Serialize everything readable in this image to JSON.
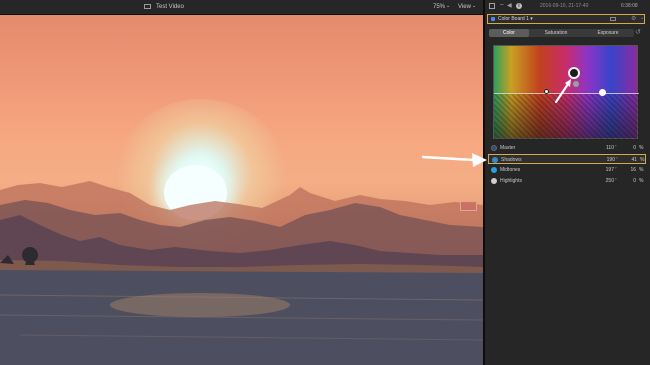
{
  "viewer": {
    "title": "Test Video",
    "zoom": "75%",
    "zoom_chevron": "⌄",
    "view_label": "View",
    "view_chevron": "⌄"
  },
  "status": {
    "wifi": "⌔",
    "volume": "◀",
    "info": "i",
    "timestamp": "2016-09-10, 21-17-40",
    "clock": "6:38:08"
  },
  "inspector": {
    "board_name": "Color Board 1 ▾",
    "board_gear": "⚙",
    "board_chevron": "⌄",
    "reset_icon": "↺",
    "tabs": [
      {
        "label": "Color",
        "active": true
      },
      {
        "label": "Saturation",
        "active": false
      },
      {
        "label": "Exposure",
        "active": false
      }
    ],
    "rows": [
      {
        "label": "Master",
        "angle": "110",
        "deg": "°",
        "percent": "0",
        "pct_sign": "%",
        "icon": "master-icon",
        "icon_color": "#3b4a66",
        "selected": false
      },
      {
        "label": "Shadows",
        "angle": "190",
        "deg": "°",
        "percent": "41",
        "pct_sign": "%",
        "icon": "shadows-icon",
        "icon_color": "#2b8fcf",
        "selected": true
      },
      {
        "label": "Midtones",
        "angle": "197",
        "deg": "°",
        "percent": "16",
        "pct_sign": "%",
        "icon": "midtones-icon",
        "icon_color": "#2aa0d8",
        "selected": false
      },
      {
        "label": "Highlights",
        "angle": "250",
        "deg": "°",
        "percent": "0",
        "pct_sign": "%",
        "icon": "highlights-icon",
        "icon_color": "#cfcfcf",
        "selected": false
      }
    ]
  },
  "colors": {
    "accent_outline": "#d8a94a",
    "panel_bg": "#262626",
    "board_blue": "#4a8ae8"
  }
}
